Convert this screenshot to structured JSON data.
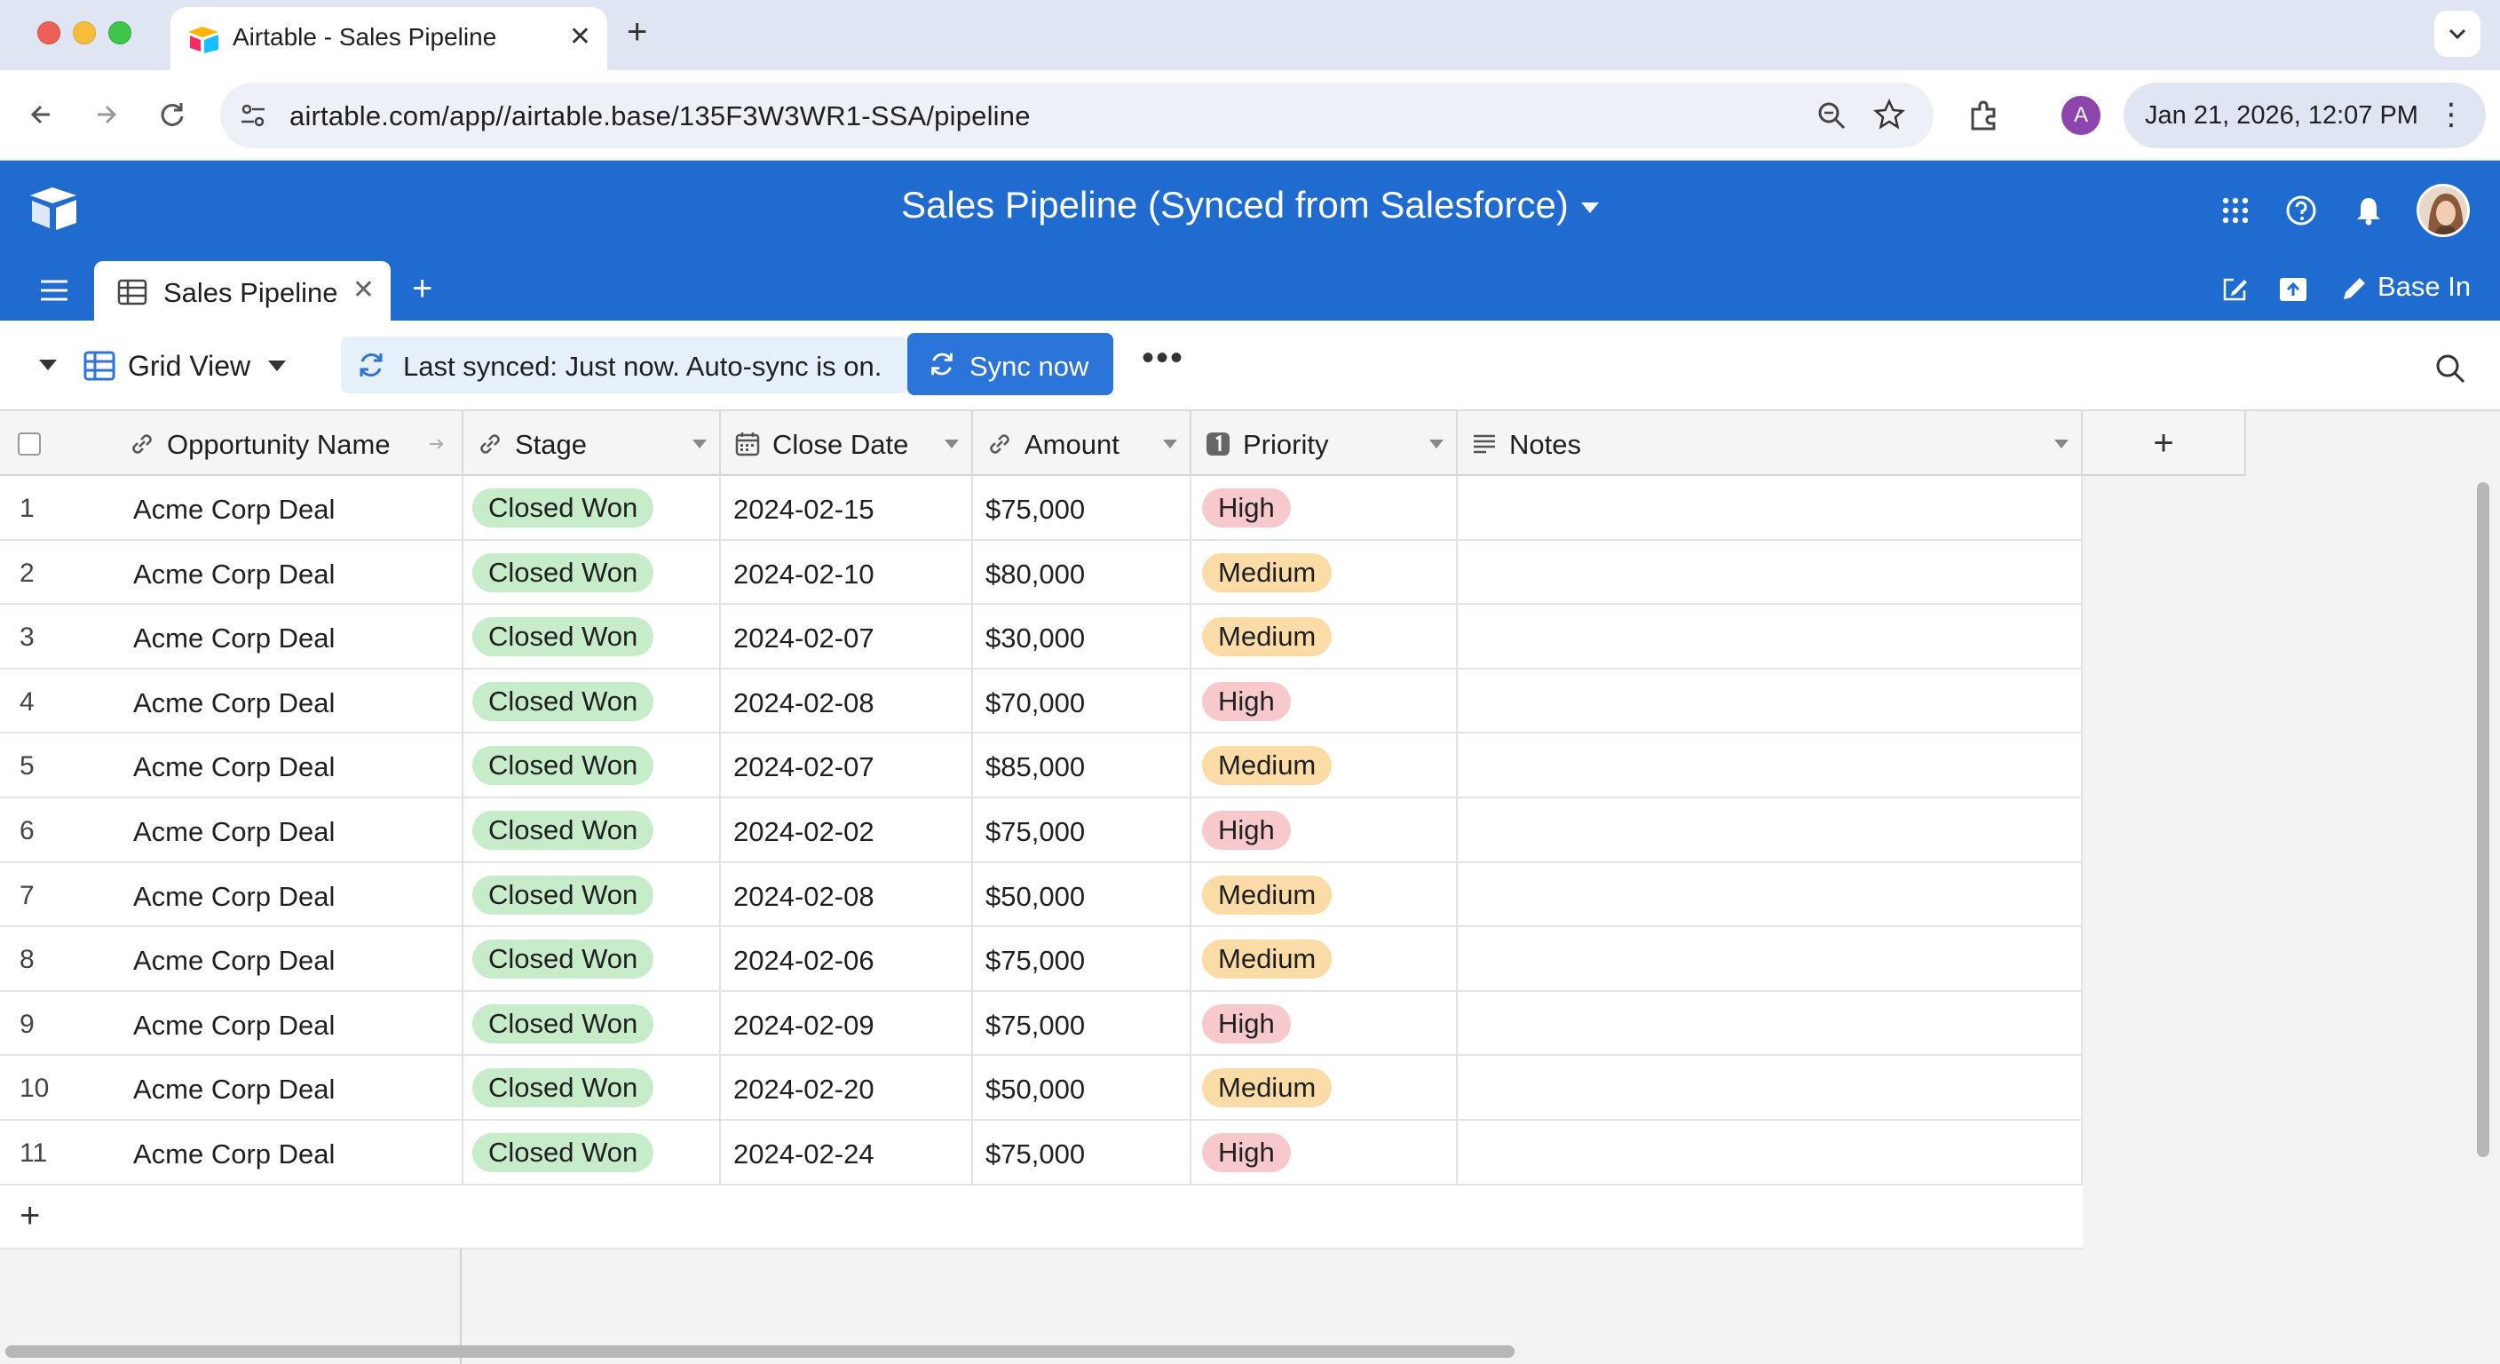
{
  "browser": {
    "tab_title": "Airtable - Sales Pipeline",
    "url": "airtable.com/app//airtable.base/135F3W3WR1-SSA/pipeline",
    "profile_initial": "A",
    "datetime": "Jan 21, 2026, 12:07 PM"
  },
  "header": {
    "base_title": "Sales Pipeline (Synced from Salesforce)",
    "table_tab": "Sales Pipeline",
    "base_in_label": "Base In"
  },
  "toolbar": {
    "view_name": "Grid View",
    "sync_status": "Last synced: Just now. Auto-sync is on.",
    "sync_button": "Sync now"
  },
  "columns": [
    {
      "label": "Opportunity Name",
      "icon": "link-icon"
    },
    {
      "label": "Stage",
      "icon": "link-icon"
    },
    {
      "label": "Close Date",
      "icon": "calendar-icon"
    },
    {
      "label": "Amount",
      "icon": "link-icon"
    },
    {
      "label": "Priority",
      "icon": "number-one-icon"
    },
    {
      "label": "Notes",
      "icon": "long-text-icon"
    }
  ],
  "rows": [
    {
      "num": "1",
      "name": "Acme Corp Deal",
      "stage": "Closed Won",
      "close_date": "2024-02-15",
      "amount": "$75,000",
      "priority": "High",
      "notes": ""
    },
    {
      "num": "2",
      "name": "Acme Corp Deal",
      "stage": "Closed Won",
      "close_date": "2024-02-10",
      "amount": "$80,000",
      "priority": "Medium",
      "notes": ""
    },
    {
      "num": "3",
      "name": "Acme Corp Deal",
      "stage": "Closed Won",
      "close_date": "2024-02-07",
      "amount": "$30,000",
      "priority": "Medium",
      "notes": ""
    },
    {
      "num": "4",
      "name": "Acme Corp Deal",
      "stage": "Closed Won",
      "close_date": "2024-02-08",
      "amount": "$70,000",
      "priority": "High",
      "notes": ""
    },
    {
      "num": "5",
      "name": "Acme Corp Deal",
      "stage": "Closed Won",
      "close_date": "2024-02-07",
      "amount": "$85,000",
      "priority": "Medium",
      "notes": ""
    },
    {
      "num": "6",
      "name": "Acme Corp Deal",
      "stage": "Closed Won",
      "close_date": "2024-02-02",
      "amount": "$75,000",
      "priority": "High",
      "notes": ""
    },
    {
      "num": "7",
      "name": "Acme Corp Deal",
      "stage": "Closed Won",
      "close_date": "2024-02-08",
      "amount": "$50,000",
      "priority": "Medium",
      "notes": ""
    },
    {
      "num": "8",
      "name": "Acme Corp Deal",
      "stage": "Closed Won",
      "close_date": "2024-02-06",
      "amount": "$75,000",
      "priority": "Medium",
      "notes": ""
    },
    {
      "num": "9",
      "name": "Acme Corp Deal",
      "stage": "Closed Won",
      "close_date": "2024-02-09",
      "amount": "$75,000",
      "priority": "High",
      "notes": ""
    },
    {
      "num": "10",
      "name": "Acme Corp Deal",
      "stage": "Closed Won",
      "close_date": "2024-02-20",
      "amount": "$50,000",
      "priority": "Medium",
      "notes": ""
    },
    {
      "num": "11",
      "name": "Acme Corp Deal",
      "stage": "Closed Won",
      "close_date": "2024-02-24",
      "amount": "$75,000",
      "priority": "High",
      "notes": ""
    }
  ],
  "colors": {
    "header_blue": "#1f6bd0",
    "sync_button": "#2b74da",
    "stage_pill": "#c7ecc9",
    "priority_high": "#f7c9cc",
    "priority_medium": "#fbdca7"
  }
}
